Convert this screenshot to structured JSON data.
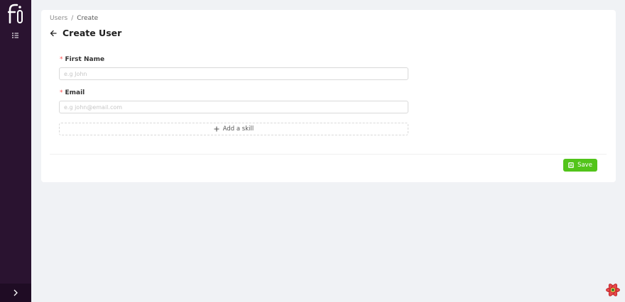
{
  "app": {
    "logo_icon": "fi-logo-icon"
  },
  "sidebar": {
    "menu_icon": "list-icon",
    "collapse_icon": "chevron-right-icon",
    "background": "#2a1330"
  },
  "breadcrumb": {
    "items": [
      "Users",
      "Create"
    ],
    "separator": "/"
  },
  "page": {
    "title": "Create User",
    "back_icon": "arrow-left-icon"
  },
  "form": {
    "first_name": {
      "label": "First Name",
      "required_mark": "*",
      "placeholder": "e.g John",
      "value": ""
    },
    "email": {
      "label": "Email",
      "required_mark": "*",
      "placeholder": "e.g john@email.com",
      "value": ""
    },
    "add_skill_label": "Add a skill"
  },
  "actions": {
    "save_label": "Save",
    "save_color": "#52c41a"
  },
  "devtools": {
    "icon": "react-query-devtools-icon"
  }
}
